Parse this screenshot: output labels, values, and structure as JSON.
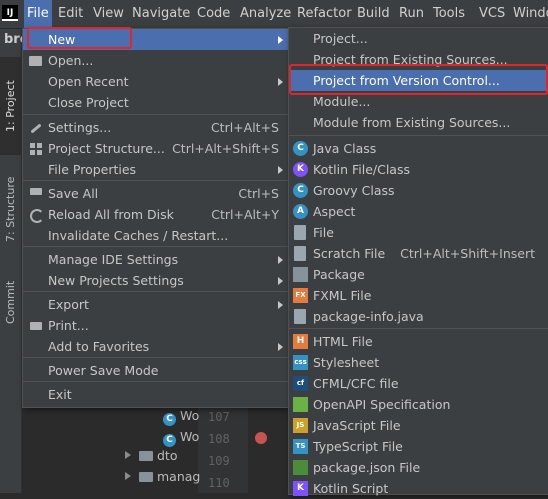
{
  "app_icon": "IJ",
  "menubar": {
    "items": [
      "File",
      "Edit",
      "View",
      "Navigate",
      "Code",
      "Analyze",
      "Refactor",
      "Build",
      "Run",
      "Tools",
      "VCS",
      "Windo"
    ]
  },
  "background": {
    "project_label": "bro",
    "tool_tabs": [
      "1: Project",
      "7: Structure",
      "Commit"
    ],
    "line_numbers": [
      "107",
      "108",
      "109",
      "110"
    ],
    "tree": [
      {
        "kind": "class",
        "label": "Wo"
      },
      {
        "kind": "class",
        "label": "Wo"
      },
      {
        "kind": "folder",
        "label": "dto"
      },
      {
        "kind": "folder",
        "label": "manag"
      }
    ]
  },
  "file_menu": {
    "items": [
      {
        "label": "New",
        "shortcut": "",
        "submenu": true,
        "icon": ""
      },
      {
        "label": "Open...",
        "shortcut": "",
        "submenu": false,
        "icon": "folder-icon"
      },
      {
        "label": "Open Recent",
        "shortcut": "",
        "submenu": true,
        "icon": ""
      },
      {
        "label": "Close Project",
        "shortcut": "",
        "submenu": false,
        "icon": ""
      },
      {
        "label": "Settings...",
        "shortcut": "Ctrl+Alt+S",
        "submenu": false,
        "icon": "wrench-icon"
      },
      {
        "label": "Project Structure...",
        "shortcut": "Ctrl+Alt+Shift+S",
        "submenu": false,
        "icon": "project-structure-icon"
      },
      {
        "label": "File Properties",
        "shortcut": "",
        "submenu": true,
        "icon": ""
      },
      {
        "label": "Save All",
        "shortcut": "Ctrl+S",
        "submenu": false,
        "icon": "save-icon"
      },
      {
        "label": "Reload All from Disk",
        "shortcut": "Ctrl+Alt+Y",
        "submenu": false,
        "icon": "reload-icon"
      },
      {
        "label": "Invalidate Caches / Restart...",
        "shortcut": "",
        "submenu": false,
        "icon": ""
      },
      {
        "label": "Manage IDE Settings",
        "shortcut": "",
        "submenu": true,
        "icon": ""
      },
      {
        "label": "New Projects Settings",
        "shortcut": "",
        "submenu": true,
        "icon": ""
      },
      {
        "label": "Export",
        "shortcut": "",
        "submenu": true,
        "icon": ""
      },
      {
        "label": "Print...",
        "shortcut": "",
        "submenu": false,
        "icon": "print-icon"
      },
      {
        "label": "Add to Favorites",
        "shortcut": "",
        "submenu": true,
        "icon": ""
      },
      {
        "label": "Power Save Mode",
        "shortcut": "",
        "submenu": false,
        "icon": ""
      },
      {
        "label": "Exit",
        "shortcut": "",
        "submenu": false,
        "icon": ""
      }
    ]
  },
  "new_submenu": {
    "items": [
      {
        "label": "Project...",
        "shortcut": "",
        "icon": ""
      },
      {
        "label": "Project from Existing Sources...",
        "shortcut": "",
        "icon": ""
      },
      {
        "label": "Project from Version Control...",
        "shortcut": "",
        "icon": ""
      },
      {
        "label": "Module...",
        "shortcut": "",
        "icon": ""
      },
      {
        "label": "Module from Existing Sources...",
        "shortcut": "",
        "icon": ""
      },
      {
        "label": "Java Class",
        "shortcut": "",
        "icon": "java-class-icon",
        "glyph": "C",
        "color": "#3592c4"
      },
      {
        "label": "Kotlin File/Class",
        "shortcut": "",
        "icon": "kotlin-icon",
        "glyph": "K",
        "color": "#7f52ff"
      },
      {
        "label": "Groovy Class",
        "shortcut": "",
        "icon": "groovy-class-icon",
        "glyph": "C",
        "color": "#3592c4"
      },
      {
        "label": "Aspect",
        "shortcut": "",
        "icon": "aspect-icon",
        "glyph": "A",
        "color": "#3592c4"
      },
      {
        "label": "File",
        "shortcut": "",
        "icon": "file-icon",
        "glyph": "",
        "color": "#9aa7b0"
      },
      {
        "label": "Scratch File",
        "shortcut": "Ctrl+Alt+Shift+Insert",
        "icon": "scratch-file-icon",
        "glyph": "",
        "color": "#9aa7b0"
      },
      {
        "label": "Package",
        "shortcut": "",
        "icon": "package-icon",
        "glyph": "",
        "color": "#87939a"
      },
      {
        "label": "FXML File",
        "shortcut": "",
        "icon": "fxml-icon",
        "glyph": "FX",
        "color": "#e57b3c"
      },
      {
        "label": "package-info.java",
        "shortcut": "",
        "icon": "package-info-icon",
        "glyph": "",
        "color": "#9aa7b0"
      },
      {
        "label": "HTML File",
        "shortcut": "",
        "icon": "html-icon",
        "glyph": "H",
        "color": "#e57b3c"
      },
      {
        "label": "Stylesheet",
        "shortcut": "",
        "icon": "css-icon",
        "glyph": "css",
        "color": "#3592c4"
      },
      {
        "label": "CFML/CFC file",
        "shortcut": "",
        "icon": "cfml-icon",
        "glyph": "cf",
        "color": "#1f4d79"
      },
      {
        "label": "OpenAPI Specification",
        "shortcut": "",
        "icon": "openapi-icon",
        "glyph": "",
        "color": "#6bb246"
      },
      {
        "label": "JavaScript File",
        "shortcut": "",
        "icon": "javascript-icon",
        "glyph": "JS",
        "color": "#c9a12b"
      },
      {
        "label": "TypeScript File",
        "shortcut": "",
        "icon": "typescript-icon",
        "glyph": "TS",
        "color": "#3592c4"
      },
      {
        "label": "package.json File",
        "shortcut": "",
        "icon": "package-json-icon",
        "glyph": "",
        "color": "#4a8c3a"
      },
      {
        "label": "Kotlin Script",
        "shortcut": "",
        "icon": "kotlin-script-icon",
        "glyph": "K",
        "color": "#7f52ff"
      }
    ]
  },
  "colors": {
    "highlight": "#4b6eaf",
    "annotation_red": "#e0262a",
    "menu_bg": "#3c3f41"
  }
}
